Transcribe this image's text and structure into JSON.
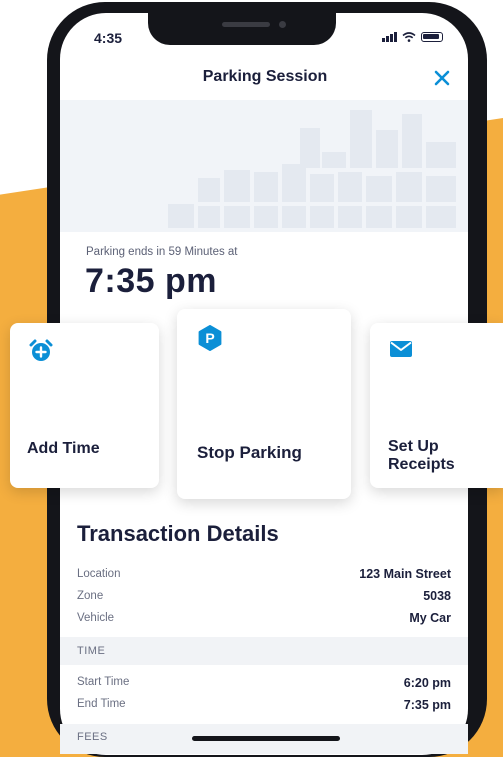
{
  "status_bar": {
    "time": "4:35"
  },
  "header": {
    "title": "Parking Session",
    "close_icon": "close-icon"
  },
  "session": {
    "ends_label": "Parking ends in 59 Minutes at",
    "ends_time": "7:35 pm"
  },
  "actions": [
    {
      "label": "Add Time",
      "icon": "alarm-clock-add-icon"
    },
    {
      "label": "Stop Parking",
      "icon": "parking-icon"
    },
    {
      "label": "Set Up Receipts",
      "icon": "envelope-icon"
    }
  ],
  "transaction": {
    "title": "Transaction Details",
    "rows": [
      {
        "label": "Location",
        "value": "123 Main Street"
      },
      {
        "label": "Zone",
        "value": "5038"
      },
      {
        "label": "Vehicle",
        "value": "My Car"
      }
    ],
    "time_section": {
      "label": "TIME",
      "rows": [
        {
          "label": "Start Time",
          "value": "6:20 pm"
        },
        {
          "label": "End Time",
          "value": "7:35 pm"
        }
      ]
    },
    "fees_section": {
      "label": "FEES"
    }
  },
  "colors": {
    "accent": "#0b8fd6",
    "text_dark": "#1b1f3b",
    "background_orange": "#f4ae3f"
  }
}
